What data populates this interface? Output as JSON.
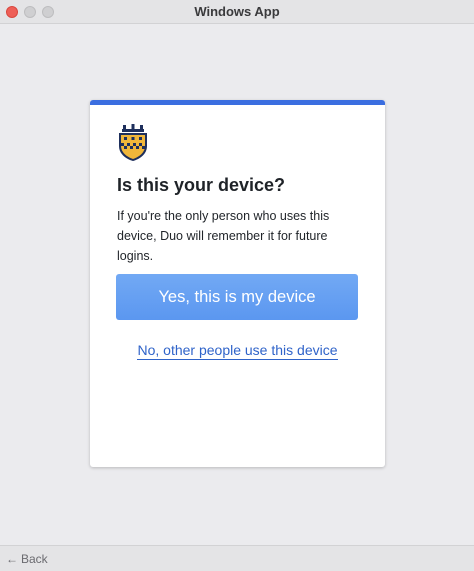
{
  "window": {
    "title": "Windows App"
  },
  "card": {
    "accent_color": "#3b6ee0",
    "logo": "shield-crest-icon",
    "heading": "Is this your device?",
    "description": "If you're the only person who uses this device, Duo will remember it for future logins.",
    "primary_button_label": "Yes, this is my device",
    "secondary_link_label": "No, other people use this device"
  },
  "footer": {
    "back_icon": "arrow-left-icon",
    "back_label": "Back"
  }
}
